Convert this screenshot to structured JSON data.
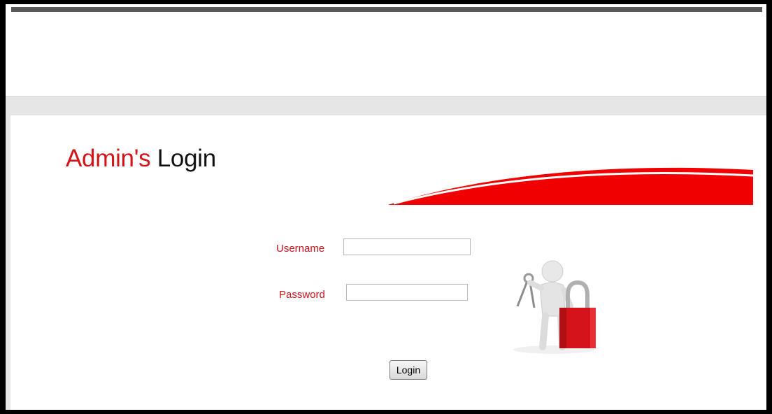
{
  "page": {
    "title_accent": "Admin's",
    "title_rest": "Login"
  },
  "form": {
    "username_label": "Username",
    "username_value": "",
    "password_label": "Password",
    "password_value": "",
    "login_label": "Login"
  },
  "illustration": {
    "icon": "person-keys-padlock-icon",
    "padlock_color": "#d4141a"
  },
  "colors": {
    "accent": "#d4141a",
    "band": "#e6e6e6",
    "top_rule": "#5a5a5a"
  }
}
